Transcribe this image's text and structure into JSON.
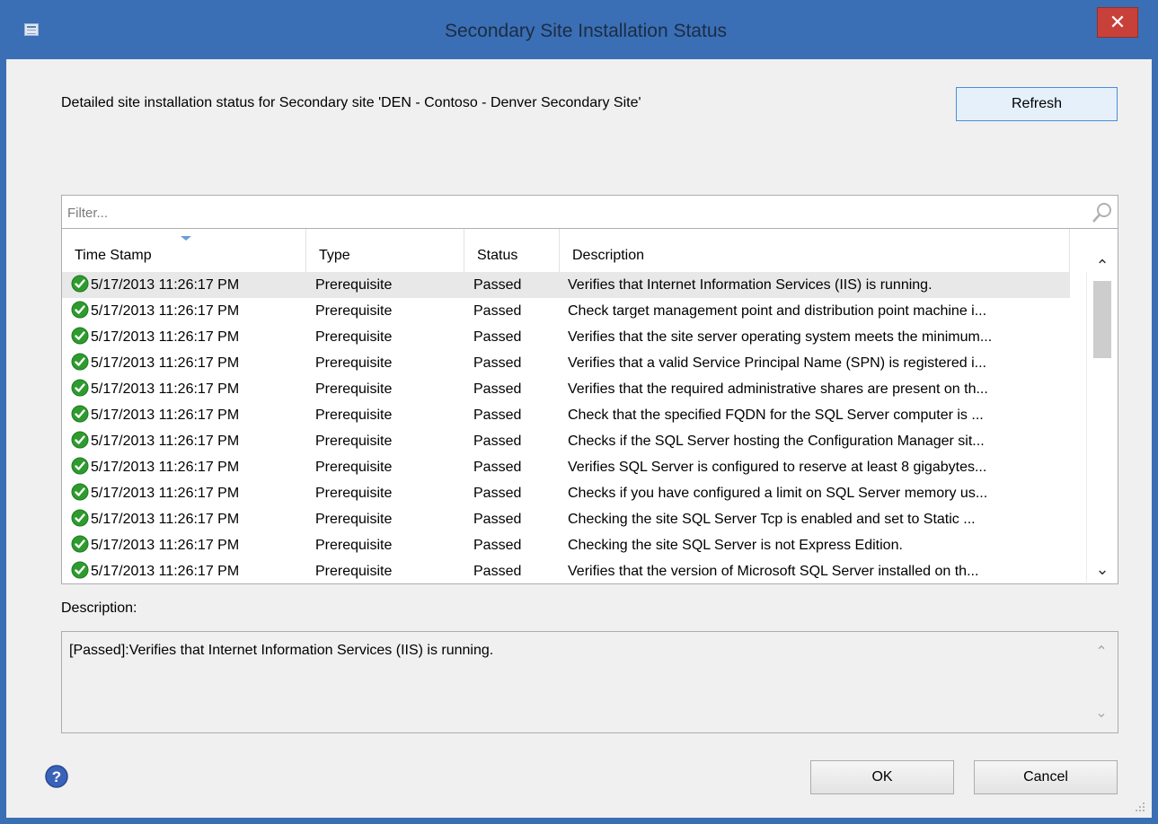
{
  "window": {
    "title": "Secondary Site Installation Status",
    "close_label": "✕"
  },
  "main": {
    "status_text": "Detailed site installation status for Secondary site 'DEN - Contoso - Denver Secondary Site'",
    "refresh_label": "Refresh"
  },
  "filter": {
    "placeholder": "Filter..."
  },
  "table": {
    "columns": [
      "Time Stamp",
      "Type",
      "Status",
      "Description"
    ],
    "rows": [
      {
        "timestamp": "5/17/2013 11:26:17 PM",
        "type": "Prerequisite",
        "status": "Passed",
        "description": "Verifies that Internet Information Services (IIS) is running."
      },
      {
        "timestamp": "5/17/2013 11:26:17 PM",
        "type": "Prerequisite",
        "status": "Passed",
        "description": "Check target management point and distribution point machine i..."
      },
      {
        "timestamp": "5/17/2013 11:26:17 PM",
        "type": "Prerequisite",
        "status": "Passed",
        "description": "Verifies that the site server operating system meets the minimum..."
      },
      {
        "timestamp": "5/17/2013 11:26:17 PM",
        "type": "Prerequisite",
        "status": "Passed",
        "description": "Verifies that a valid Service Principal Name (SPN) is registered i..."
      },
      {
        "timestamp": "5/17/2013 11:26:17 PM",
        "type": "Prerequisite",
        "status": "Passed",
        "description": "Verifies that the required administrative shares are present on th..."
      },
      {
        "timestamp": "5/17/2013 11:26:17 PM",
        "type": "Prerequisite",
        "status": "Passed",
        "description": "Check that the specified FQDN for the SQL Server computer is ..."
      },
      {
        "timestamp": "5/17/2013 11:26:17 PM",
        "type": "Prerequisite",
        "status": "Passed",
        "description": "Checks if the SQL Server hosting the Configuration Manager sit..."
      },
      {
        "timestamp": "5/17/2013 11:26:17 PM",
        "type": "Prerequisite",
        "status": "Passed",
        "description": "Verifies SQL Server is configured to reserve at least 8 gigabytes..."
      },
      {
        "timestamp": "5/17/2013 11:26:17 PM",
        "type": "Prerequisite",
        "status": "Passed",
        "description": "Checks if you have configured a limit on SQL Server memory us..."
      },
      {
        "timestamp": "5/17/2013 11:26:17 PM",
        "type": "Prerequisite",
        "status": "Passed",
        "description": "Checking the site SQL Server Tcp is enabled and set to Static ..."
      },
      {
        "timestamp": "5/17/2013 11:26:17 PM",
        "type": "Prerequisite",
        "status": "Passed",
        "description": "Checking the site SQL Server is not Express Edition."
      },
      {
        "timestamp": "5/17/2013 11:26:17 PM",
        "type": "Prerequisite",
        "status": "Passed",
        "description": "Verifies that the version of Microsoft SQL Server installed on th..."
      }
    ],
    "selected_row": 0
  },
  "details": {
    "label": "Description:",
    "text": "[Passed]:Verifies that Internet Information Services (IIS) is running."
  },
  "footer": {
    "ok_label": "OK",
    "cancel_label": "Cancel"
  },
  "icons": {
    "title": "dialog-icon",
    "close": "close-icon",
    "search": "search-icon",
    "row_status": "check-icon",
    "help": "help-icon"
  },
  "colors": {
    "titlebar": "#3a6fb5",
    "close": "#c7413a",
    "passed": "#2e9b2e",
    "help": "#3a62b8"
  }
}
